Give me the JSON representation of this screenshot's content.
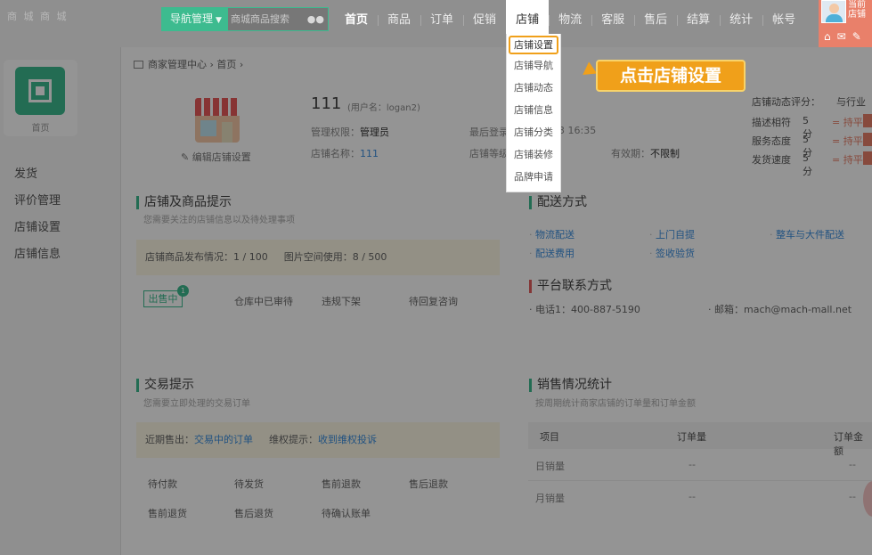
{
  "top": {
    "logo": "商 城 商 城",
    "nav_mgmt": "导航管理",
    "search_placeholder": "商城商品搜索",
    "nav": [
      "首页",
      "商品",
      "订单",
      "促销",
      "店铺",
      "物流",
      "客服",
      "售后",
      "结算",
      "统计",
      "帐号"
    ],
    "user_name": "当前\n店铺"
  },
  "store_dropdown": [
    "店铺设置",
    "店铺导航",
    "店铺动态",
    "店铺信息",
    "店铺分类",
    "店铺装修",
    "品牌申请"
  ],
  "callout": "点击店铺设置",
  "sidebar": {
    "home_label": "首页",
    "items": [
      "发货",
      "评价管理",
      "店铺设置",
      "店铺信息"
    ]
  },
  "breadcrumb": [
    "商家管理中心",
    "首页"
  ],
  "store": {
    "name": "111",
    "username_label": "(用户名：logan2)",
    "edit_link": "编辑店铺设置",
    "perm_label": "管理权限：",
    "perm_value": "管理员",
    "store_name_label": "店铺名称：",
    "store_name_value": "111",
    "last_login_label": "最后登录",
    "last_login_value": "3 16:35",
    "grade_label": "店铺等级",
    "valid_label": "有效期：",
    "valid_value": "不限制"
  },
  "rating": {
    "title": "店铺动态评分：",
    "compare": "与行业",
    "rows": [
      {
        "label": "描述相符",
        "score": "5 分",
        "cmp": "= 持平"
      },
      {
        "label": "服务态度",
        "score": "5 分",
        "cmp": "= 持平"
      },
      {
        "label": "发货速度",
        "score": "5 分",
        "cmp": "= 持平"
      }
    ]
  },
  "goods_tips": {
    "title": "店铺及商品提示",
    "sub": "您需要关注的店铺信息以及待处理事项",
    "publish": "店铺商品发布情况：1 / 100",
    "space": "图片空间使用：8 / 500",
    "onsale": "出售中",
    "onsale_count": "1",
    "items": [
      "仓库中已审待",
      "违规下架",
      "待回复咨询"
    ]
  },
  "delivery": {
    "title": "配送方式",
    "links": [
      "物流配送",
      "上门自提",
      "整车与大件配送",
      "配送费用",
      "签收验货"
    ]
  },
  "contact": {
    "title": "平台联系方式",
    "phone": "电话1：400-887-5190",
    "email": "邮箱：mach@mach-mall.net"
  },
  "trade": {
    "title": "交易提示",
    "sub": "您需要立即处理的交易订单",
    "recent_label": "近期售出：",
    "recent_link": "交易中的订单",
    "rights_label": "维权提示：",
    "rights_link": "收到维权投诉",
    "items": [
      "待付款",
      "待发货",
      "售前退款",
      "售后退款",
      "售前退货",
      "售后退货",
      "待确认账单"
    ]
  },
  "sales": {
    "title": "销售情况统计",
    "sub": "按周期统计商家店铺的订单量和订单金额",
    "cols": [
      "项目",
      "订单量",
      "订单金额"
    ],
    "rows": [
      {
        "item": "日销量",
        "count": "--",
        "amount": "--"
      },
      {
        "item": "月销量",
        "count": "--",
        "amount": "--"
      }
    ]
  }
}
